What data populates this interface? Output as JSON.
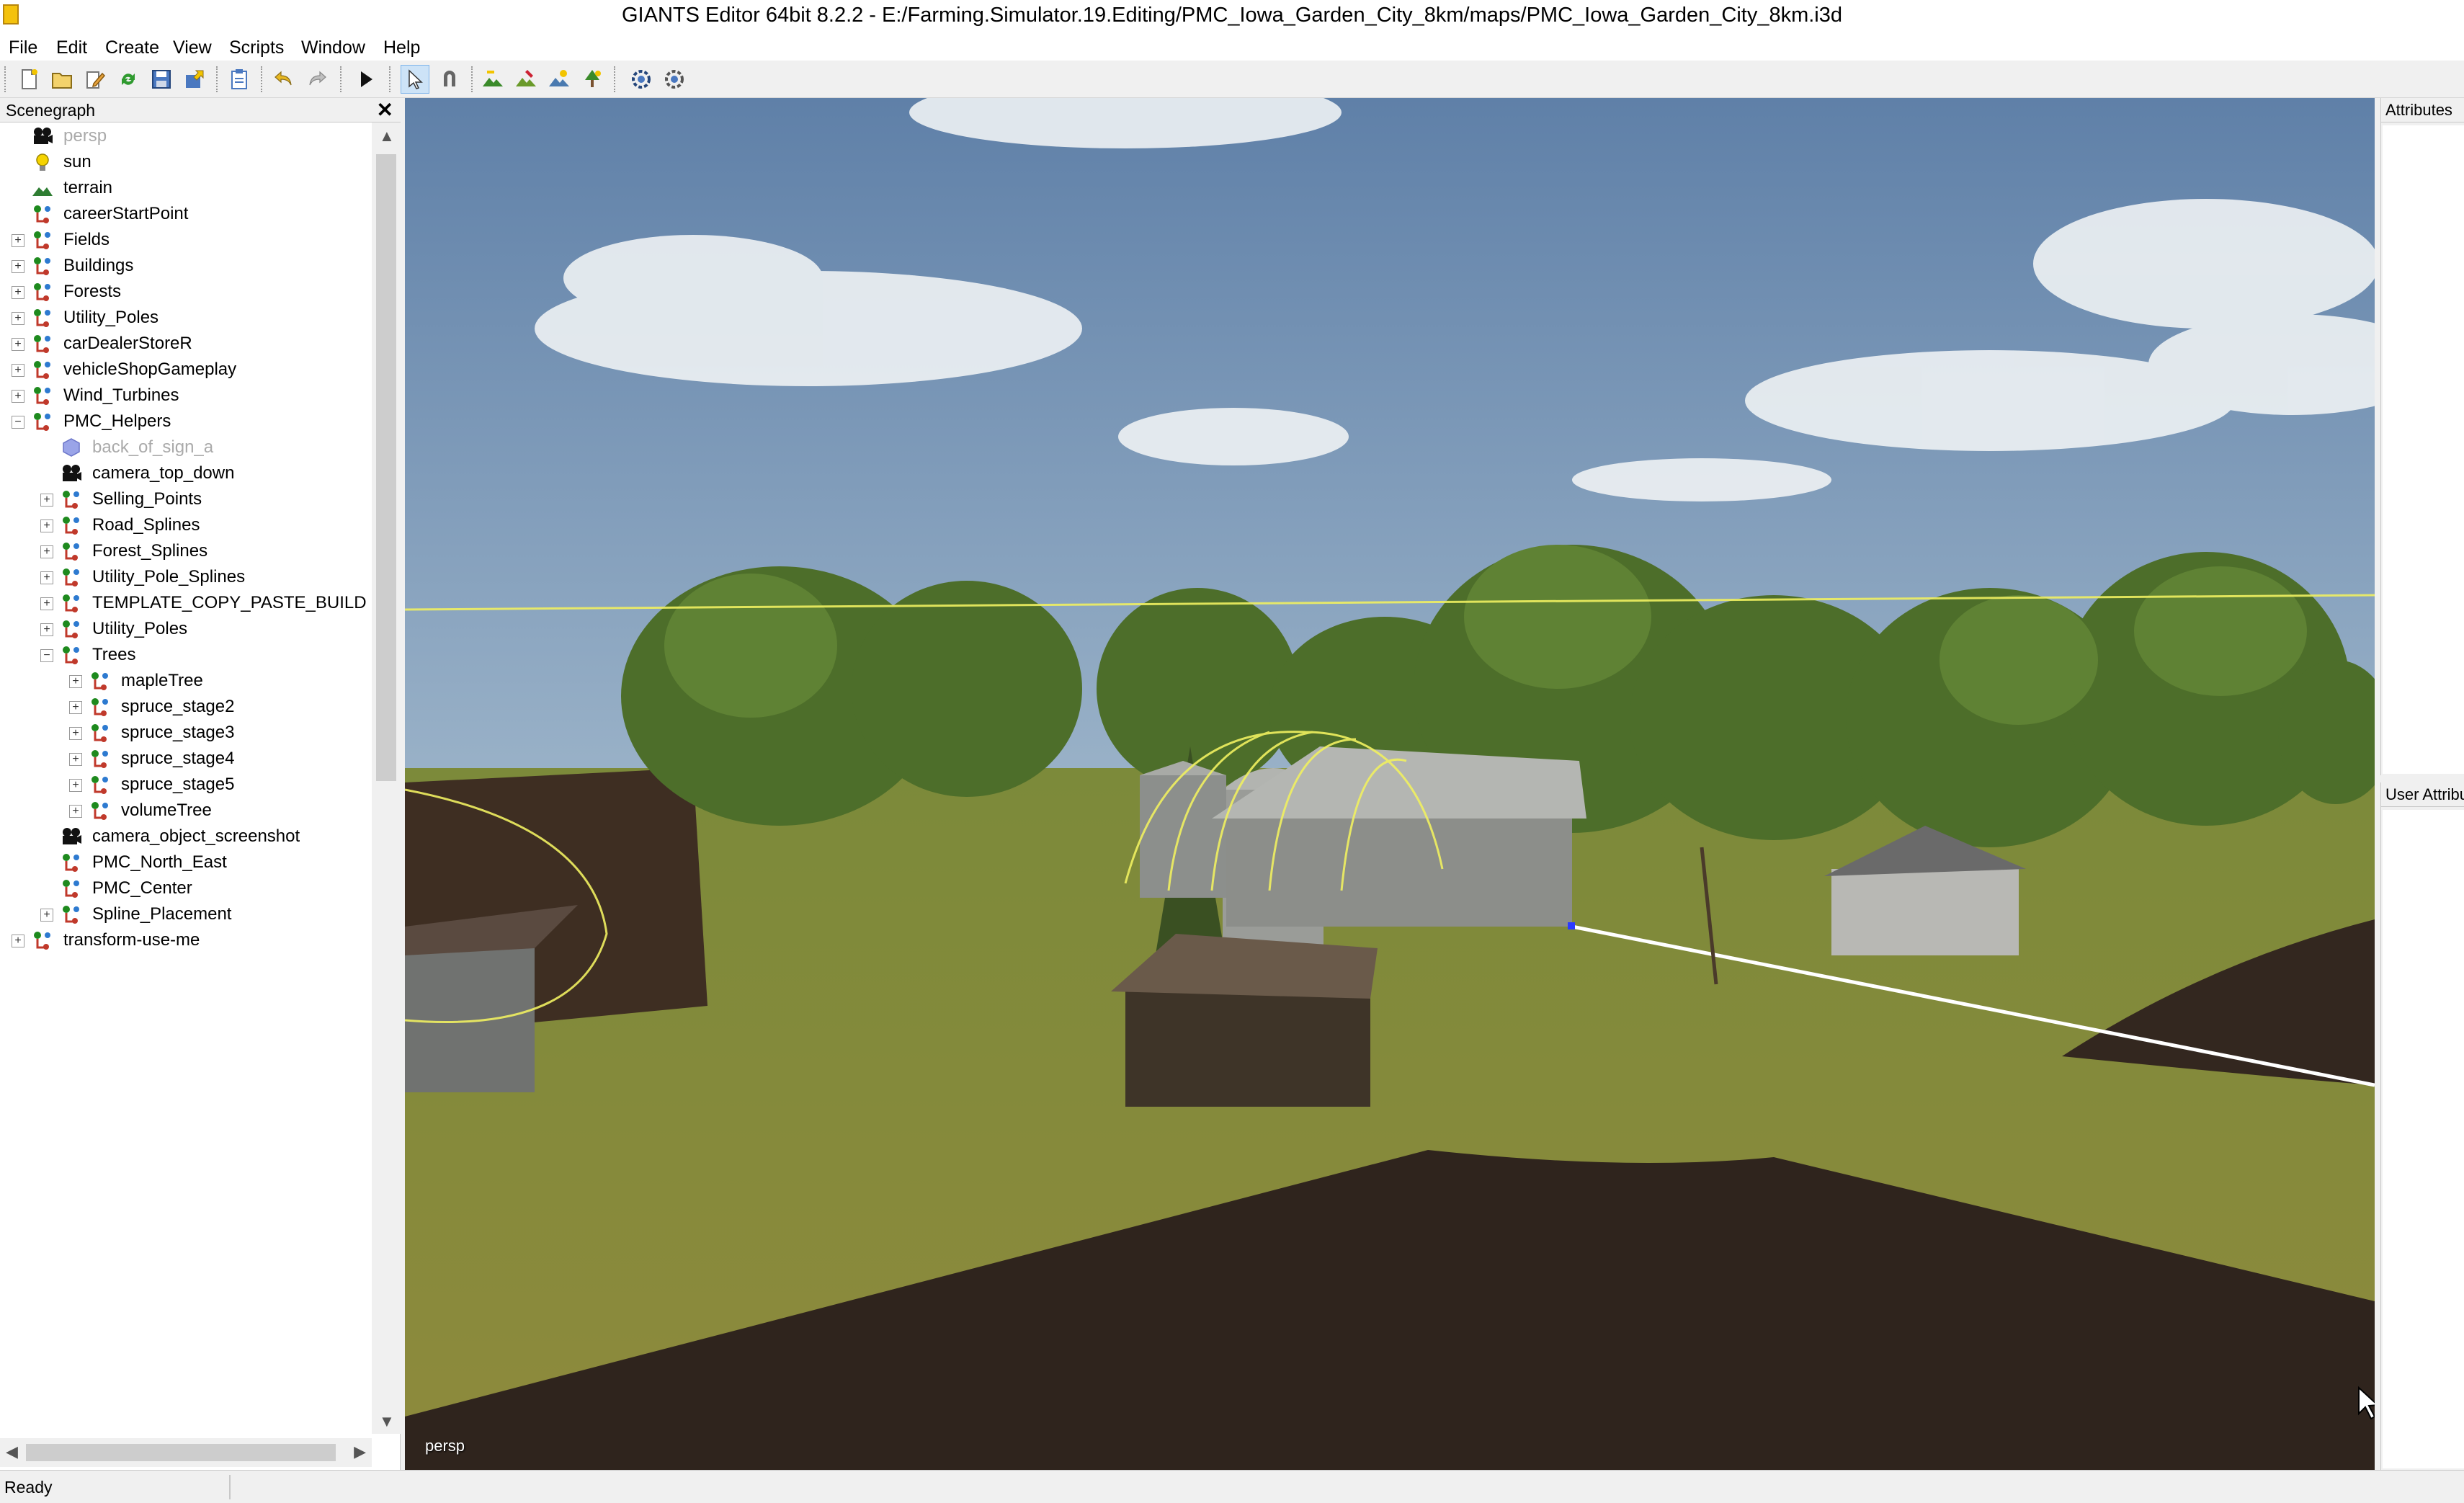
{
  "window": {
    "title": "GIANTS Editor 64bit 8.2.2 - E:/Farming.Simulator.19.Editing/PMC_Iowa_Garden_City_8km/maps/PMC_Iowa_Garden_City_8km.i3d"
  },
  "menu": {
    "file": "File",
    "edit": "Edit",
    "create": "Create",
    "view": "View",
    "scripts": "Scripts",
    "window": "Window",
    "help": "Help"
  },
  "scenegraph": {
    "title": "Scenegraph",
    "close": "✕",
    "nodes": [
      {
        "label": "persp",
        "type": "camera",
        "depth": 0,
        "exp": "",
        "dim": true
      },
      {
        "label": "sun",
        "type": "light",
        "depth": 0,
        "exp": ""
      },
      {
        "label": "terrain",
        "type": "terrain",
        "depth": 0,
        "exp": ""
      },
      {
        "label": "careerStartPoint",
        "type": "transform",
        "depth": 0,
        "exp": ""
      },
      {
        "label": "Fields",
        "type": "transform",
        "depth": 0,
        "exp": "+"
      },
      {
        "label": "Buildings",
        "type": "transform",
        "depth": 0,
        "exp": "+"
      },
      {
        "label": "Forests",
        "type": "transform",
        "depth": 0,
        "exp": "+"
      },
      {
        "label": "Utility_Poles",
        "type": "transform",
        "depth": 0,
        "exp": "+"
      },
      {
        "label": "carDealerStoreR",
        "type": "transform",
        "depth": 0,
        "exp": "+"
      },
      {
        "label": "vehicleShopGameplay",
        "type": "transform",
        "depth": 0,
        "exp": "+"
      },
      {
        "label": "Wind_Turbines",
        "type": "transform",
        "depth": 0,
        "exp": "+"
      },
      {
        "label": "PMC_Helpers",
        "type": "transform",
        "depth": 0,
        "exp": "−"
      },
      {
        "label": "back_of_sign_a",
        "type": "shape",
        "depth": 1,
        "exp": "",
        "dim": true
      },
      {
        "label": "camera_top_down",
        "type": "camera",
        "depth": 1,
        "exp": ""
      },
      {
        "label": "Selling_Points",
        "type": "transform",
        "depth": 1,
        "exp": "+"
      },
      {
        "label": "Road_Splines",
        "type": "transform",
        "depth": 1,
        "exp": "+"
      },
      {
        "label": "Forest_Splines",
        "type": "transform",
        "depth": 1,
        "exp": "+"
      },
      {
        "label": "Utility_Pole_Splines",
        "type": "transform",
        "depth": 1,
        "exp": "+"
      },
      {
        "label": "TEMPLATE_COPY_PASTE_BUILD",
        "type": "transform",
        "depth": 1,
        "exp": "+"
      },
      {
        "label": "Utility_Poles",
        "type": "transform",
        "depth": 1,
        "exp": "+"
      },
      {
        "label": "Trees",
        "type": "transform",
        "depth": 1,
        "exp": "−"
      },
      {
        "label": "mapleTree",
        "type": "transform",
        "depth": 2,
        "exp": "+"
      },
      {
        "label": "spruce_stage2",
        "type": "transform",
        "depth": 2,
        "exp": "+"
      },
      {
        "label": "spruce_stage3",
        "type": "transform",
        "depth": 2,
        "exp": "+"
      },
      {
        "label": "spruce_stage4",
        "type": "transform",
        "depth": 2,
        "exp": "+"
      },
      {
        "label": "spruce_stage5",
        "type": "transform",
        "depth": 2,
        "exp": "+"
      },
      {
        "label": "volumeTree",
        "type": "transform",
        "depth": 2,
        "exp": "+"
      },
      {
        "label": "camera_object_screenshot",
        "type": "camera",
        "depth": 1,
        "exp": ""
      },
      {
        "label": "PMC_North_East",
        "type": "transform",
        "depth": 1,
        "exp": ""
      },
      {
        "label": "PMC_Center",
        "type": "transform",
        "depth": 1,
        "exp": ""
      },
      {
        "label": "Spline_Placement",
        "type": "transform",
        "depth": 1,
        "exp": "+"
      },
      {
        "label": "transform-use-me",
        "type": "transform",
        "depth": 0,
        "exp": "+"
      }
    ]
  },
  "viewport": {
    "camera_label": "persp"
  },
  "attributes": {
    "title": "Attributes"
  },
  "user_attributes": {
    "title": "User Attributes"
  },
  "status": {
    "text": "Ready"
  },
  "icons": {
    "camera": "camera-icon",
    "light": "lightbulb-icon",
    "terrain": "terrain-icon",
    "transform": "transform-group-icon",
    "shape": "shape-cube-icon"
  },
  "colors": {
    "selection_yellow": "#f0f060",
    "spline_white": "#ffffff"
  }
}
